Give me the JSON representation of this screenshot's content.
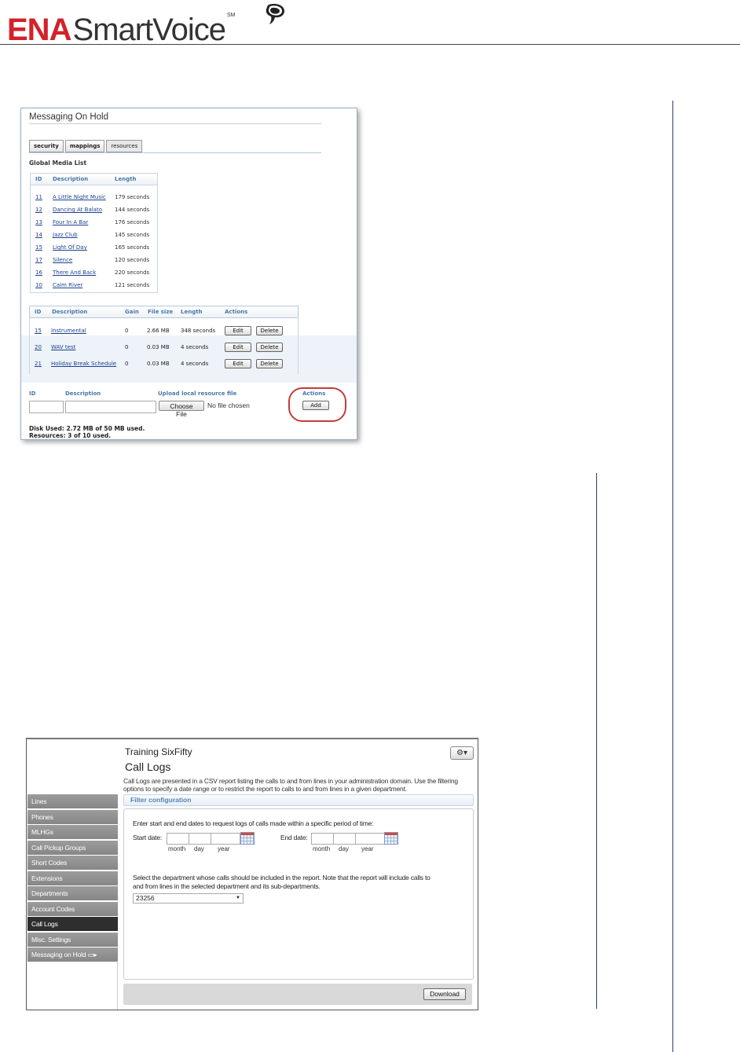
{
  "header": {
    "logo_ena": "ENA",
    "logo_rest": "SmartVoice",
    "logo_sm": "SM"
  },
  "moh": {
    "title": "Messaging On Hold",
    "tabs": [
      "security",
      "mappings",
      "resources"
    ],
    "active_tab": "resources",
    "global_media_label": "Global Media List",
    "gml_headers": {
      "id": "ID",
      "description": "Description",
      "length": "Length"
    },
    "gml_rows": [
      {
        "id": "11",
        "desc": "A Little Night Music",
        "len": "179 seconds"
      },
      {
        "id": "12",
        "desc": "Dancing At Balato",
        "len": "144 seconds"
      },
      {
        "id": "13",
        "desc": "Four In A Bar",
        "len": "176 seconds"
      },
      {
        "id": "14",
        "desc": "Jazz Club",
        "len": "145 seconds"
      },
      {
        "id": "15",
        "desc": "Light Of Day",
        "len": "165 seconds"
      },
      {
        "id": "17",
        "desc": "Silence",
        "len": "120 seconds"
      },
      {
        "id": "16",
        "desc": "There And Back",
        "len": "220 seconds"
      },
      {
        "id": "10",
        "desc": "Calm River",
        "len": "121 seconds"
      }
    ],
    "res_headers": {
      "id": "ID",
      "description": "Description",
      "gain": "Gain",
      "file_size": "File size",
      "length": "Length",
      "actions": "Actions"
    },
    "res_rows": [
      {
        "id": "15",
        "desc": "Instrumental",
        "gain": "0",
        "size": "2.66 MB",
        "len": "348 seconds"
      },
      {
        "id": "20",
        "desc": "WAV test",
        "gain": "0",
        "size": "0.03 MB",
        "len": "4 seconds"
      },
      {
        "id": "21",
        "desc": "Holiday Break Schedule",
        "gain": "0",
        "size": "0.03 MB",
        "len": "4 seconds"
      }
    ],
    "edit_label": "Edit",
    "delete_label": "Delete",
    "form": {
      "id_label": "ID",
      "desc_label": "Description",
      "upload_label": "Upload local resource file",
      "actions_label": "Actions",
      "choose_file": "Choose File",
      "no_file": "No file chosen",
      "add_label": "Add"
    },
    "disk_used": "Disk Used: 2.72 MB of 50 MB used.",
    "resources_used": "Resources: 3 of 10 used."
  },
  "calllogs": {
    "account": "Training SixFifty",
    "title": "Call Logs",
    "description": "Call Logs are presented in a CSV report listing the calls to and from lines in your administration domain. Use the filtering options to specify a date range or to restrict the report to calls to and from lines in a given department.",
    "sidebar": [
      "Lines",
      "Phones",
      "MLHGs",
      "Call Pickup Groups",
      "Short Codes",
      "Extensions",
      "Departments",
      "Account Codes",
      "Call Logs",
      "Misc. Settings",
      "Messaging on Hold ▭▸"
    ],
    "active_item": "Call Logs",
    "filter_label": "Filter configuration",
    "date_instructions": "Enter start and end dates to request logs of calls made within a specific period of time:",
    "start_label": "Start date:",
    "end_label": "End date:",
    "month": "month",
    "day": "day",
    "year": "year",
    "dept_instructions_1": "Select the department whose calls should be included in the report. Note that the report will include calls to",
    "dept_instructions_2": "and from lines in the selected department and its sub-departments.",
    "dept_value": "23256",
    "download_label": "Download",
    "gear_glyph": "⚙▾"
  }
}
